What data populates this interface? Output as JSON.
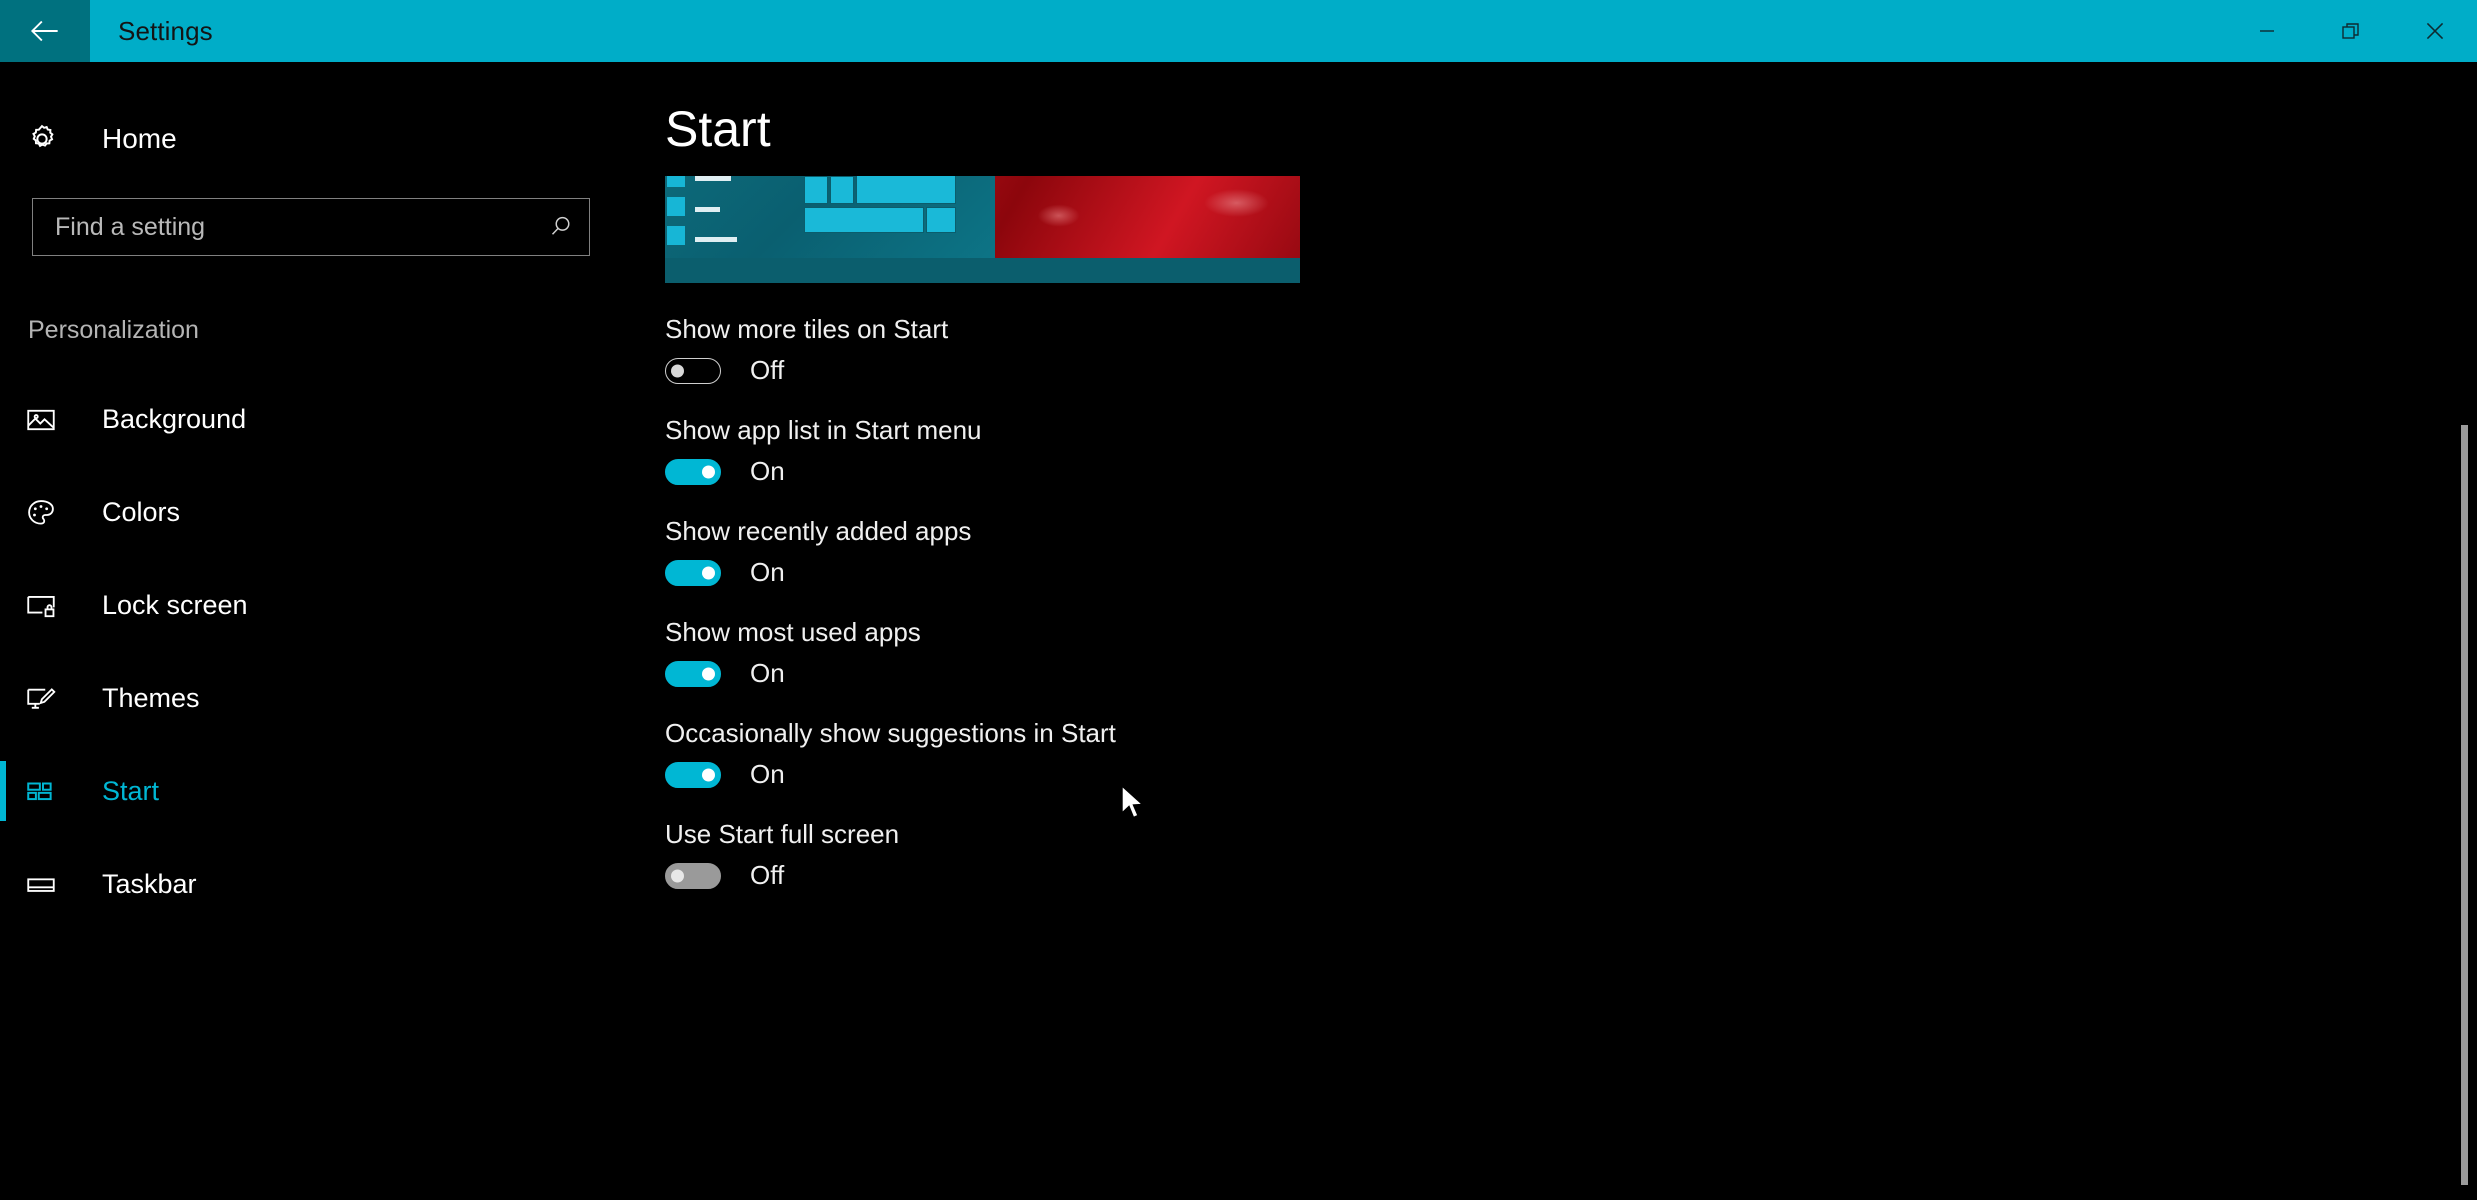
{
  "titlebar": {
    "back_label": "Back",
    "title": "Settings",
    "minimize_label": "Minimize",
    "restore_label": "Restore",
    "close_label": "Close",
    "background_color": "#00adc8",
    "back_button_color": "#00717f"
  },
  "sidebar": {
    "home": {
      "label": "Home",
      "icon": "gear-icon"
    },
    "search": {
      "placeholder": "Find a setting",
      "value": "",
      "icon": "search-icon"
    },
    "group_title": "Personalization",
    "items": [
      {
        "label": "Background",
        "icon": "picture-icon",
        "selected": false
      },
      {
        "label": "Colors",
        "icon": "palette-icon",
        "selected": false
      },
      {
        "label": "Lock screen",
        "icon": "lock-screen-icon",
        "selected": false
      },
      {
        "label": "Themes",
        "icon": "themes-brush-icon",
        "selected": false
      },
      {
        "label": "Start",
        "icon": "start-tiles-icon",
        "selected": true
      },
      {
        "label": "Taskbar",
        "icon": "taskbar-icon",
        "selected": false
      }
    ],
    "accent_color": "#00b7d4"
  },
  "main": {
    "page_title": "Start",
    "preview": {
      "name": "start-menu-preview",
      "wallpaper_color": "#c8121c",
      "tile_color": "#1ab9d8",
      "menu_color": "#0a5f70"
    },
    "settings": [
      {
        "label": "Show more tiles on Start",
        "state": "Off",
        "on": false,
        "hover": false
      },
      {
        "label": "Show app list in Start menu",
        "state": "On",
        "on": true,
        "hover": false
      },
      {
        "label": "Show recently added apps",
        "state": "On",
        "on": true,
        "hover": false
      },
      {
        "label": "Show most used apps",
        "state": "On",
        "on": true,
        "hover": false
      },
      {
        "label": "Occasionally show suggestions in Start",
        "state": "On",
        "on": true,
        "hover": false
      },
      {
        "label": "Use Start full screen",
        "state": "Off",
        "on": false,
        "hover": true
      }
    ]
  },
  "scrollbar": {
    "name": "vertical-scrollbar",
    "thumb_color": "#9b9b9b"
  }
}
